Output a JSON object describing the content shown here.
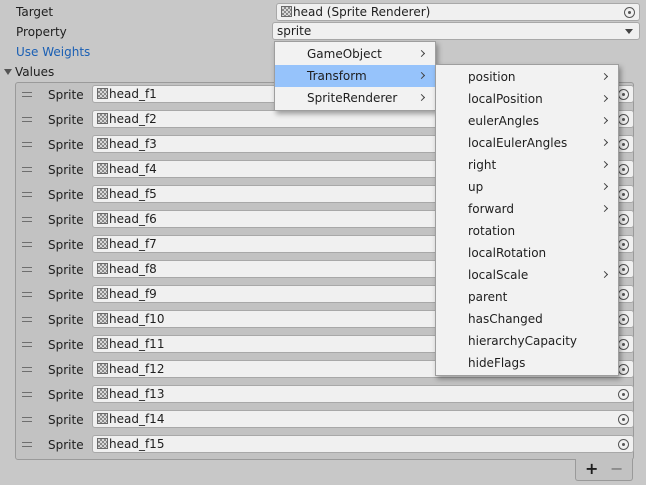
{
  "inspector": {
    "target_label": "Target",
    "target_value": "head (Sprite Renderer)",
    "property_label": "Property",
    "property_value": "sprite",
    "use_weights": "Use Weights",
    "values_label": "Values"
  },
  "values": [
    {
      "label": "Sprite",
      "value": "head_f1"
    },
    {
      "label": "Sprite",
      "value": "head_f2"
    },
    {
      "label": "Sprite",
      "value": "head_f3"
    },
    {
      "label": "Sprite",
      "value": "head_f4"
    },
    {
      "label": "Sprite",
      "value": "head_f5"
    },
    {
      "label": "Sprite",
      "value": "head_f6"
    },
    {
      "label": "Sprite",
      "value": "head_f7"
    },
    {
      "label": "Sprite",
      "value": "head_f8"
    },
    {
      "label": "Sprite",
      "value": "head_f9"
    },
    {
      "label": "Sprite",
      "value": "head_f10"
    },
    {
      "label": "Sprite",
      "value": "head_f11"
    },
    {
      "label": "Sprite",
      "value": "head_f12"
    },
    {
      "label": "Sprite",
      "value": "head_f13"
    },
    {
      "label": "Sprite",
      "value": "head_f14"
    },
    {
      "label": "Sprite",
      "value": "head_f15"
    }
  ],
  "list_footer": {
    "add": "+",
    "remove": "−"
  },
  "menu": {
    "items": [
      {
        "label": "GameObject",
        "submenu": true,
        "selected": false
      },
      {
        "label": "Transform",
        "submenu": true,
        "selected": true
      },
      {
        "label": "SpriteRenderer",
        "submenu": true,
        "selected": false
      }
    ]
  },
  "submenu": {
    "items": [
      {
        "label": "position",
        "submenu": true
      },
      {
        "label": "localPosition",
        "submenu": true
      },
      {
        "label": "eulerAngles",
        "submenu": true
      },
      {
        "label": "localEulerAngles",
        "submenu": true
      },
      {
        "label": "right",
        "submenu": true
      },
      {
        "label": "up",
        "submenu": true
      },
      {
        "label": "forward",
        "submenu": true
      },
      {
        "label": "rotation",
        "submenu": false
      },
      {
        "label": "localRotation",
        "submenu": false
      },
      {
        "label": "localScale",
        "submenu": true
      },
      {
        "label": "parent",
        "submenu": false
      },
      {
        "label": "hasChanged",
        "submenu": false
      },
      {
        "label": "hierarchyCapacity",
        "submenu": false
      },
      {
        "label": "hideFlags",
        "submenu": false
      }
    ]
  },
  "colors": {
    "link": "#1a5fb4",
    "selection": "#96c3fb"
  }
}
